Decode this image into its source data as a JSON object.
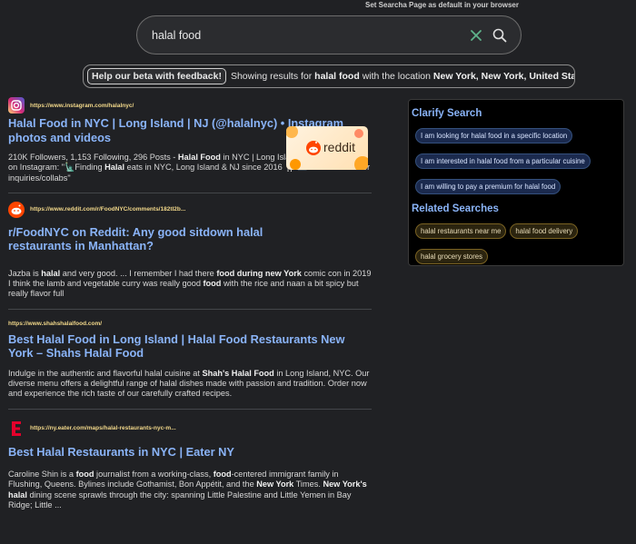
{
  "header": {
    "default_link": "Set Searcha Page as default in your browser"
  },
  "search": {
    "query": "halal food",
    "clear_icon": "close-icon",
    "submit_icon": "search-icon"
  },
  "beta": {
    "button": "Help our beta with feedback!",
    "prefix": "Showing results for",
    "query": "halal food",
    "middle": "with the location",
    "location": "New York, New York, United States"
  },
  "results": [
    {
      "url": "https://www.instagram.com/halalnyc/",
      "icon": "instagram-icon",
      "title": "Halal Food in NYC | Long Island | NJ (@halalnyc) • Instagram photos and videos",
      "snippet": [
        {
          "t": "210K Followers, 1,153 Following, 296 Posts - "
        },
        {
          "t": "Halal Food",
          "b": true
        },
        {
          "t": " in NYC | Long Island | NJ (@halalnyc) on Instagram: \"🗽Finding "
        },
        {
          "t": "Halal",
          "b": true
        },
        {
          "t": " eats in NYC, Long Island & NJ since 2016 🍴 📧 Please email for inquiries/collabs\""
        }
      ]
    },
    {
      "url": "https://www.reddit.com/r/FoodNYC/comments/182tl2b...",
      "icon": "reddit-icon",
      "title": "r/FoodNYC on Reddit: Any good sitdown halal restaurants in Manhattan?",
      "thumbnail": "reddit",
      "snippet": [
        {
          "t": "Jazba is "
        },
        {
          "t": "halal",
          "b": true
        },
        {
          "t": " and very good. ... I remember I had there "
        },
        {
          "t": "food during new York",
          "b": true
        },
        {
          "t": " comic con in 2019 I think the lamb and vegetable curry was really good "
        },
        {
          "t": "food",
          "b": true
        },
        {
          "t": " with the rice and naan a bit spicy but really flavor full"
        }
      ]
    },
    {
      "url": "https://www.shahshalalfood.com/",
      "icon": "",
      "title": "Best Halal Food in Long Island | Halal Food Restaurants New York – Shahs Halal Food",
      "snippet": [
        {
          "t": "Indulge in the authentic and flavorful halal cuisine at "
        },
        {
          "t": "Shah's Halal Food",
          "b": true
        },
        {
          "t": " in Long Island, NYC. Our diverse menu offers a delightful range of halal dishes made with passion and tradition. Order now and experience the rich taste of our carefully crafted recipes."
        }
      ]
    },
    {
      "url": "https://ny.eater.com/maps/halal-restaurants-nyc-m...",
      "icon": "eater-icon",
      "title": "Best Halal Restaurants in NYC | Eater NY",
      "snippet": [
        {
          "t": "Caroline Shin is a "
        },
        {
          "t": "food",
          "b": true
        },
        {
          "t": " journalist from a working-class, "
        },
        {
          "t": "food",
          "b": true
        },
        {
          "t": "-centered immigrant family in Flushing, Queens. Bylines include Gothamist, Bon Appétit, and the "
        },
        {
          "t": "New York",
          "b": true
        },
        {
          "t": " Times. "
        },
        {
          "t": "New York's halal",
          "b": true
        },
        {
          "t": " dining scene sprawls through the city: spanning Little Palestine and Little Yemen in Bay Ridge; Little ..."
        }
      ]
    }
  ],
  "sidebar": {
    "clarify_title": "Clarify Search",
    "clarify": [
      "I am looking for halal food in a specific location",
      "I am interested in halal food from a particular cuisine",
      "I am willing to pay a premium for halal food"
    ],
    "related_title": "Related Searches",
    "related": [
      "halal restaurants near me",
      "halal food delivery",
      "halal grocery stores"
    ]
  },
  "thumb_text": "reddit",
  "colors": {
    "accent": "#8ab4f8",
    "url": "#f2d88a",
    "background": "#202124",
    "instagram": "#d6249f",
    "reddit": "#ff4500",
    "eater": "#e4002b"
  }
}
